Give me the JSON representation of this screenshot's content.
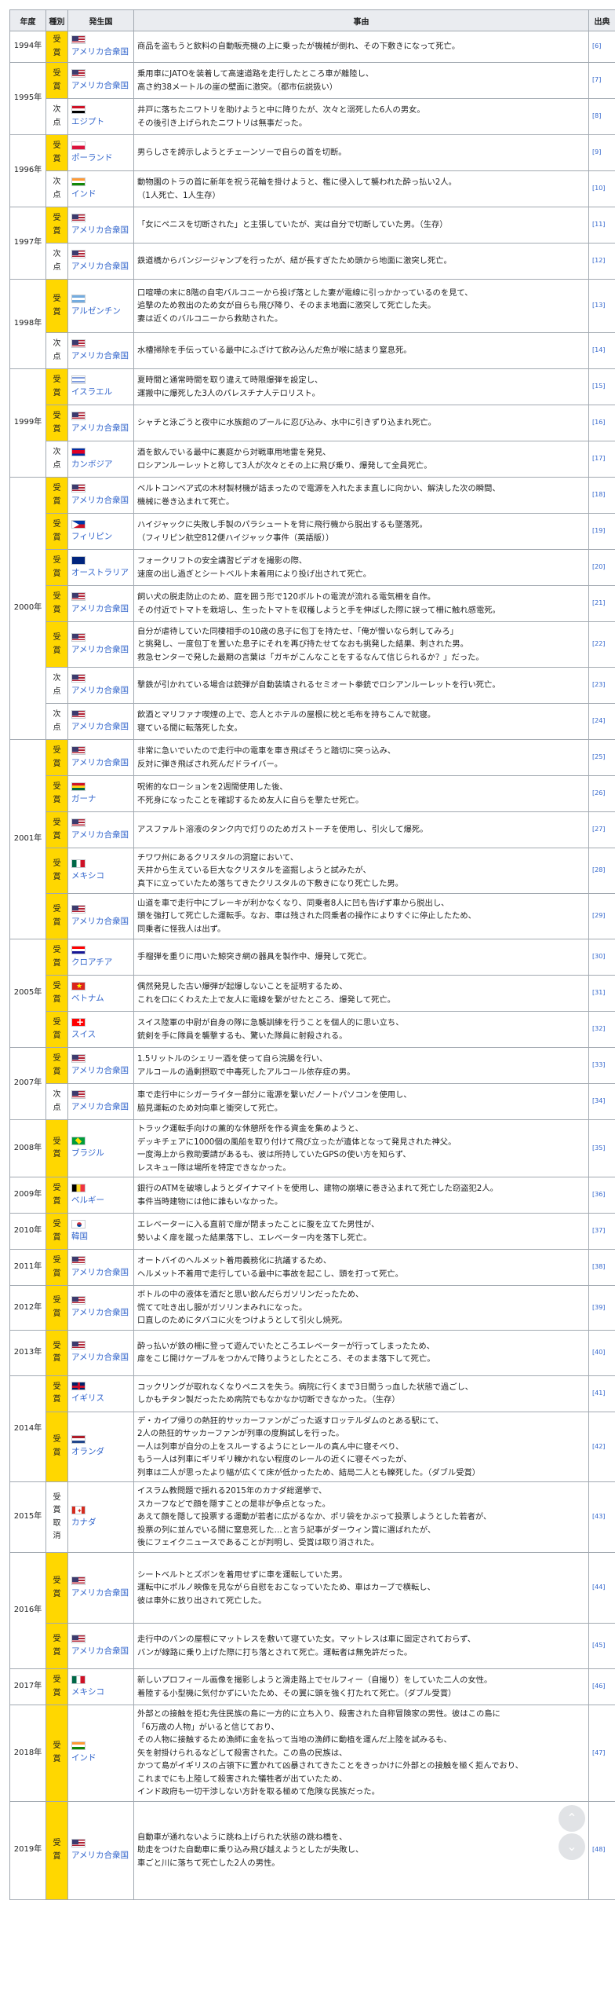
{
  "headers": {
    "year": "年度",
    "kind": "種別",
    "country": "発生国",
    "reason": "事由",
    "source": "出典"
  },
  "rows": [
    {
      "year": "1994年",
      "kind": "受賞",
      "award": true,
      "country": "アメリカ合衆国",
      "flag": "us",
      "ref": "[6]",
      "lines": [
        "商品を盗もうと飲料の自動販売機の上に乗ったが機械が倒れ、その下敷きになって死亡。"
      ]
    },
    {
      "year": "1995年",
      "kind": "受賞",
      "award": true,
      "country": "アメリカ合衆国",
      "flag": "us",
      "ref": "[7]",
      "lines": [
        "乗用車にJATOを装着して高速道路を走行したところ車が離陸し、",
        "高さ約38メートルの崖の壁面に激突。（都市伝説扱い）"
      ]
    },
    {
      "year": "",
      "kind": "次点",
      "award": false,
      "country": "エジプト",
      "flag": "eg",
      "ref": "[8]",
      "lines": [
        "井戸に落ちたニワトリを助けようと中に降りたが、次々と溺死した6人の男女。",
        "その後引き上げられたニワトリは無事だった。"
      ]
    },
    {
      "year": "1996年",
      "kind": "受賞",
      "award": true,
      "country": "ポーランド",
      "flag": "pl",
      "ref": "[9]",
      "lines": [
        "男らしさを誇示しようとチェーンソーで自らの首を切断。"
      ]
    },
    {
      "year": "",
      "kind": "次点",
      "award": false,
      "country": "インド",
      "flag": "in",
      "ref": "[10]",
      "lines": [
        "動物園のトラの首に新年を祝う花輪を掛けようと、檻に侵入して襲われた酔っ払い2人。",
        "（1人死亡、1人生存）"
      ]
    },
    {
      "year": "1997年",
      "kind": "受賞",
      "award": true,
      "country": "アメリカ合衆国",
      "flag": "us",
      "ref": "[11]",
      "lines": [
        "「女にペニスを切断された」と主張していたが、実は自分で切断していた男。（生存）"
      ]
    },
    {
      "year": "",
      "kind": "次点",
      "award": false,
      "country": "アメリカ合衆国",
      "flag": "us",
      "ref": "[12]",
      "lines": [
        "鉄道橋からバンジージャンプを行ったが、紐が長すぎたため頭から地面に激突し死亡。"
      ]
    },
    {
      "year": "1998年",
      "kind": "受賞",
      "award": true,
      "country": "アルゼンチン",
      "flag": "ar",
      "ref": "[13]",
      "lines": [
        "口喧嘩の末に8階の自宅バルコニーから投げ落とした妻が電線に引っかかっているのを見て、",
        "追撃のため救出のため女が自らも飛び降り、そのまま地面に激突して死亡した夫。",
        "妻は近くのバルコニーから救助された。"
      ]
    },
    {
      "year": "",
      "kind": "次点",
      "award": false,
      "country": "アメリカ合衆国",
      "flag": "us",
      "ref": "[14]",
      "lines": [
        "水槽掃除を手伝っている最中にふざけて飲み込んだ魚が喉に詰まり窒息死。"
      ]
    },
    {
      "year": "1999年",
      "kind": "受賞",
      "award": true,
      "country": "イスラエル",
      "flag": "il",
      "ref": "[15]",
      "lines": [
        "夏時間と通常時間を取り違えて時限爆弾を設定し、",
        "運搬中に爆死した3人のパレスチナ人テロリスト。"
      ]
    },
    {
      "year": "",
      "kind": "受賞",
      "award": true,
      "country": "アメリカ合衆国",
      "flag": "us",
      "ref": "[16]",
      "lines": [
        "シャチと泳ごうと夜中に水族館のプールに忍び込み、水中に引きずり込まれ死亡。"
      ]
    },
    {
      "year": "",
      "kind": "次点",
      "award": false,
      "country": "カンボジア",
      "flag": "kh",
      "ref": "[17]",
      "lines": [
        "酒を飲んでいる最中に裏庭から対戦車用地雷を発見、",
        "ロシアンルーレットと称して3人が次々とその上に飛び乗り、爆発して全員死亡。"
      ]
    },
    {
      "year": "2000年",
      "kind": "受賞",
      "award": true,
      "country": "アメリカ合衆国",
      "flag": "us",
      "ref": "[18]",
      "lines": [
        "ベルトコンベア式の木材製材機が詰まったので電源を入れたまま直しに向かい、解決した次の瞬間、",
        "機械に巻き込まれて死亡。"
      ]
    },
    {
      "year": "",
      "kind": "受賞",
      "award": true,
      "country": "フィリピン",
      "flag": "ph",
      "ref": "[19]",
      "lines": [
        "ハイジャックに失敗し手製のパラシュートを背に飛行機から脱出するも墜落死。",
        "（フィリピン航空812便ハイジャック事件（英語版））"
      ]
    },
    {
      "year": "",
      "kind": "受賞",
      "award": true,
      "country": "オーストラリア",
      "flag": "au",
      "ref": "[20]",
      "lines": [
        "フォークリフトの安全講習ビデオを撮影の際、",
        "速度の出し過ぎとシートベルト未着用により投げ出されて死亡。"
      ]
    },
    {
      "year": "",
      "kind": "受賞",
      "award": true,
      "country": "アメリカ合衆国",
      "flag": "us",
      "ref": "[21]",
      "lines": [
        "飼い犬の脱走防止のため、庭を囲う形で120ボルトの電流が流れる電気柵を自作。",
        "その付近でトマトを栽培し、生ったトマトを収穫しようと手を伸ばした際に誤って柵に触れ感電死。"
      ]
    },
    {
      "year": "",
      "kind": "受賞",
      "award": true,
      "country": "アメリカ合衆国",
      "flag": "us",
      "ref": "[22]",
      "lines": [
        "自分が虐待していた同棲相手の10歳の息子に包丁を持たせ、「俺が憎いなら刺してみろ」",
        "と挑発し、一度包丁を置いた息子にそれを再び持たせてなおも挑発した結果、刺された男。",
        "救急センターで発した最期の言葉は「ガキがこんなことをするなんて信じられるか？」だった。"
      ]
    },
    {
      "year": "",
      "kind": "次点",
      "award": false,
      "country": "アメリカ合衆国",
      "flag": "us",
      "ref": "[23]",
      "lines": [
        "撃鉄が引かれている場合は銃弾が自動装填されるセミオート拳銃でロシアンルーレットを行い死亡。"
      ]
    },
    {
      "year": "",
      "kind": "次点",
      "award": false,
      "country": "アメリカ合衆国",
      "flag": "us",
      "ref": "[24]",
      "lines": [
        "飲酒とマリファナ喫煙の上で、恋人とホテルの屋根に枕と毛布を持ちこんで就寝。",
        "寝ている間に転落死した女。"
      ]
    },
    {
      "year": "2001年",
      "kind": "受賞",
      "award": true,
      "country": "アメリカ合衆国",
      "flag": "us",
      "ref": "[25]",
      "lines": [
        "非常に急いでいたので走行中の電車を車き飛ばそうと踏切に突っ込み、",
        "反対に弾き飛ばされ死んだドライバー。"
      ]
    },
    {
      "year": "",
      "kind": "受賞",
      "award": true,
      "country": "ガーナ",
      "flag": "gh",
      "ref": "[26]",
      "lines": [
        "呪術的なローションを2週間使用した後、",
        "不死身になったことを確認するため友人に自らを撃たせ死亡。"
      ]
    },
    {
      "year": "",
      "kind": "受賞",
      "award": true,
      "country": "アメリカ合衆国",
      "flag": "us",
      "ref": "[27]",
      "lines": [
        "アスファルト溶液のタンク内で灯りのためガストーチを使用し、引火して爆死。"
      ]
    },
    {
      "year": "",
      "kind": "受賞",
      "award": true,
      "country": "メキシコ",
      "flag": "mx",
      "ref": "[28]",
      "lines": [
        "チワワ州にあるクリスタルの洞窟において、",
        "天井から生えている巨大なクリスタルを盗掘しようと試みたが、",
        "真下に立っていたため落ちてきたクリスタルの下敷きになり死亡した男。"
      ]
    },
    {
      "year": "",
      "kind": "受賞",
      "award": true,
      "country": "アメリカ合衆国",
      "flag": "us",
      "ref": "[29]",
      "lines": [
        "山道を車で走行中にブレーキが利かなくなり、同乗者8人に凹も告げず車から脱出し、",
        "頭を強打して死亡した運転手。なお、車は残された同乗者の操作によりすぐに停止したため、",
        "同乗者に怪我人は出ず。"
      ]
    },
    {
      "year": "2005年",
      "kind": "受賞",
      "award": true,
      "country": "クロアチア",
      "flag": "hr",
      "ref": "[30]",
      "lines": [
        "手榴弾を重りに用いた鯨突き網の器具を製作中、爆発して死亡。"
      ]
    },
    {
      "year": "",
      "kind": "受賞",
      "award": true,
      "country": "ベトナム",
      "flag": "vn",
      "ref": "[31]",
      "lines": [
        "偶然発見した古い爆弾が起爆しないことを証明するため、",
        "これを口にくわえた上で友人に電線を繋がせたところ、爆発して死亡。"
      ]
    },
    {
      "year": "",
      "kind": "受賞",
      "award": true,
      "country": "スイス",
      "flag": "ch",
      "ref": "[32]",
      "lines": [
        "スイス陸軍の中尉が自身の隊に急襲訓練を行うことを個人的に思い立ち、",
        "銃剣を手に隊員を襲撃するも、驚いた隊員に射殺される。"
      ]
    },
    {
      "year": "2007年",
      "kind": "受賞",
      "award": true,
      "country": "アメリカ合衆国",
      "flag": "us",
      "ref": "[33]",
      "lines": [
        "1.5リットルのシェリー酒を使って自ら浣腸を行い、",
        "アルコールの過剰摂取で中毒死したアルコール依存症の男。"
      ]
    },
    {
      "year": "",
      "kind": "次点",
      "award": false,
      "country": "アメリカ合衆国",
      "flag": "us",
      "ref": "[34]",
      "lines": [
        "車で走行中にシガーライター部分に電源を繋いだノートパソコンを使用し、",
        "脇見運転のため対向車と衝突して死亡。"
      ]
    },
    {
      "year": "2008年",
      "kind": "受賞",
      "award": true,
      "country": "ブラジル",
      "flag": "br",
      "ref": "[35]",
      "lines": [
        "トラック運転手向けの薫的な休憩所を作る資金を集めようと、",
        "デッキチェアに1000個の風船を取り付けて飛び立ったが遺体となって発見された神父。",
        "一度海上から救助要請があるも、彼は所持していたGPSの使い方を知らず、",
        "レスキュー隊は場所を特定できなかった。"
      ]
    },
    {
      "year": "2009年",
      "kind": "受賞",
      "award": true,
      "country": "ベルギー",
      "flag": "be",
      "ref": "[36]",
      "lines": [
        "銀行のATMを破壊しようとダイナマイトを使用し、建物の崩壊に巻き込まれて死亡した窃盗犯2人。",
        "事件当時建物には他に誰もいなかった。"
      ]
    },
    {
      "year": "2010年",
      "kind": "受賞",
      "award": true,
      "country": "韓国",
      "flag": "kr",
      "ref": "[37]",
      "lines": [
        "エレベーターに入る直前で扉が閉まったことに腹を立てた男性が、",
        "勢いよく扉を蹴った結果落下し、エレベーター内を落下し死亡。"
      ]
    },
    {
      "year": "2011年",
      "kind": "受賞",
      "award": true,
      "country": "アメリカ合衆国",
      "flag": "us",
      "ref": "[38]",
      "lines": [
        "オートバイのヘルメット着用義務化に抗議するため、",
        "ヘルメット不着用で走行している最中に事故を起こし、頭を打って死亡。"
      ]
    },
    {
      "year": "2012年",
      "kind": "受賞",
      "award": true,
      "country": "アメリカ合衆国",
      "flag": "us",
      "ref": "[39]",
      "lines": [
        "ボトルの中の液体を酒だと思い飲んだらガソリンだったため、",
        "慌てて吐き出し服がガソリンまみれになった。",
        "口直しのためにタバコに火をつけようとして引火し焼死。"
      ]
    },
    {
      "year": "2013年",
      "kind": "受賞",
      "award": true,
      "country": "アメリカ合衆国",
      "flag": "us",
      "ref": "[40]",
      "lines": [
        "酔っ払いが鉄の柵に登って遊んでいたところエレベーターが行ってしまったため、",
        "扉をこじ開けケーブルをつかんで降りようとしたところ、そのまま落下して死亡。"
      ]
    },
    {
      "year": "2014年",
      "kind": "受賞",
      "award": true,
      "country": "イギリス",
      "flag": "gb",
      "ref": "[41]",
      "lines": [
        "コックリングが取れなくなりペニスを失う。病院に行くまで3日間うっ血した状態で過ごし、",
        "しかもチタン製だったため病院でもなかなか切断できなかった。（生存）"
      ]
    },
    {
      "year": "",
      "kind": "受賞",
      "award": true,
      "country": "オランダ",
      "flag": "nl",
      "ref": "[42]",
      "lines": [
        "デ・カイプ帰りの熱狂的サッカーファンがごった返すロッテルダムのとある駅にて、",
        "2人の熱狂的サッカーファンが列車の度胸試しを行った。",
        "一人は列車が自分の上をスルーするようにとレールの真ん中に寝そべり、",
        "もう一人は列車にギリギリ轢かれない程度のレールの近くに寝そべったが、",
        "列車は二人が思ったより幅が広くて床が低かったため、結局二人とも轢死した。（ダブル受賞）"
      ]
    },
    {
      "year": "2015年",
      "kind": "受賞\n取消",
      "award": false,
      "country": "カナダ",
      "flag": "ca",
      "ref": "[43]",
      "lines": [
        "イスラム教問題で揺れる2015年のカナダ総選挙で、",
        "スカーフなどで顔を隠すことの是非が争点となった。",
        "あえて顔を隠して投票する運動が若者に広がるなか、ポリ袋をかぶって投票しようとした若者が、",
        "投票の列に並んでいる間に窒息死した…と言う記事がダーウィン賞に選ばれたが、",
        "後にフェイクニュースであることが判明し、受賞は取り消された。"
      ]
    },
    {
      "year": "2016年",
      "kind": "受賞",
      "award": true,
      "country": "アメリカ合衆国",
      "flag": "us",
      "ref": "[44]",
      "lines": [
        "シートベルトとズボンを着用せずに車を運転していた男。",
        "運転中にポルノ映像を見ながら自慰をおこなっていたため、車はカーブで横転し、",
        "彼は車外に放り出されて死亡した。"
      ]
    },
    {
      "year": "",
      "kind": "受賞",
      "award": true,
      "country": "アメリカ合衆国",
      "flag": "us",
      "ref": "[45]",
      "lines": [
        "走行中のバンの屋根にマットレスを敷いて寝ていた女。マットレスは車に固定されておらず、",
        "バンが線路に乗り上げた際に打ち落とされて死亡。運転者は無免許だった。"
      ]
    },
    {
      "year": "2017年",
      "kind": "受賞",
      "award": true,
      "country": "メキシコ",
      "flag": "mx",
      "ref": "[46]",
      "lines": [
        "新しいプロフィール画像を撮影しようと滑走路上でセルフィー（自撮り）をしていた二人の女性。",
        "着陸する小型機に気付かずにいたため、その翼に頭を強く打たれて死亡。（ダブル受賞）"
      ]
    },
    {
      "year": "2018年",
      "kind": "受賞",
      "award": true,
      "country": "インド",
      "flag": "in",
      "ref": "[47]",
      "lines": [
        "外部との接触を拒む先住民族の島に一方的に立ち入り、殺害された自称冒険家の男性。彼はこの島に",
        "「6万歳の人物」がいると信じており、",
        "その人物に接触するため漁師に金を払って当地の漁師に動植を運んだ上陸を試みるも、",
        "矢を射掛けられるなどして殺害された。この島の民族は、",
        "かつて島がイギリスの占領下に置かれて凶暴されてきたことをきっかけに外部との接触を極く拒んでおり、",
        "これまでにも上陸して殺害された犠牲者が出ていたため、",
        "インド政府も一切干渉しない方針を取る極めて危険な民族だった。"
      ]
    },
    {
      "year": "2019年",
      "kind": "受賞",
      "award": true,
      "country": "アメリカ合衆国",
      "flag": "us",
      "ref": "[48]",
      "lines": [
        "自動車が通れないように跳ね上げられた状態の跳ね橋を、",
        "助走をつけた自動車に乗り込み飛び越えようとしたが失敗し、",
        "車ごと川に落ちて死亡した2人の男性。"
      ]
    }
  ]
}
